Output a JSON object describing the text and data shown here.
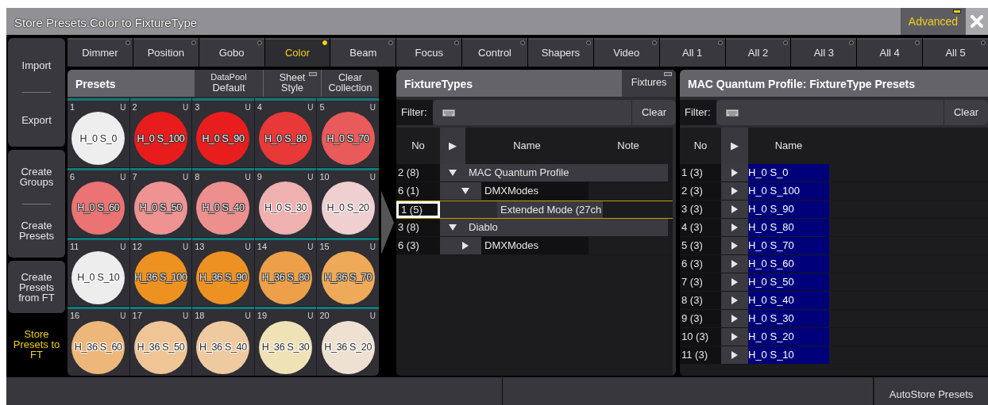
{
  "window": {
    "title": "Store Presets.Color to FixtureType"
  },
  "mode_button": {
    "label": "Advanced",
    "on": true
  },
  "sidebar": [
    {
      "items": [
        {
          "label": "Import",
          "selected": false
        },
        {
          "label": "Export",
          "selected": false
        }
      ]
    },
    {
      "items": [
        {
          "label": "Create Groups",
          "selected": false
        },
        {
          "label": "Create Presets",
          "selected": false
        }
      ]
    },
    {
      "items": [
        {
          "label": "Create Presets from FT",
          "selected": false
        }
      ]
    },
    {
      "items": [
        {
          "label": "Store Presets to FT",
          "selected": true
        }
      ]
    }
  ],
  "tabs": [
    {
      "label": "Dimmer",
      "selected": false
    },
    {
      "label": "Position",
      "selected": false
    },
    {
      "label": "Gobo",
      "selected": false
    },
    {
      "label": "Color",
      "selected": true
    },
    {
      "label": "Beam",
      "selected": false
    },
    {
      "label": "Focus",
      "selected": false
    },
    {
      "label": "Control",
      "selected": false
    },
    {
      "label": "Shapers",
      "selected": false
    },
    {
      "label": "Video",
      "selected": false
    },
    {
      "label": "All 1",
      "selected": false
    },
    {
      "label": "All 2",
      "selected": false
    },
    {
      "label": "All 3",
      "selected": false
    },
    {
      "label": "All 4",
      "selected": false
    },
    {
      "label": "All 5",
      "selected": false
    }
  ],
  "presets": {
    "title": "Presets",
    "datapool": {
      "label": "DataPool",
      "value": "Default"
    },
    "buttons": [
      "Sheet Style",
      "Clear Collection"
    ],
    "items": [
      {
        "number": "1",
        "flag": "U",
        "name": "H_0 S_0",
        "color": "#eeeeee"
      },
      {
        "number": "2",
        "flag": "U",
        "name": "H_0 S_100",
        "color": "#e81c1c"
      },
      {
        "number": "3",
        "flag": "U",
        "name": "H_0 S_90",
        "color": "#e81e1e"
      },
      {
        "number": "4",
        "flag": "U",
        "name": "H_0 S_80",
        "color": "#e83838"
      },
      {
        "number": "5",
        "flag": "U",
        "name": "H_0 S_70",
        "color": "#e95a5a"
      },
      {
        "number": "6",
        "flag": "U",
        "name": "H_0 S_60",
        "color": "#ec7373"
      },
      {
        "number": "7",
        "flag": "U",
        "name": "H_0 S_50",
        "color": "#ee9292"
      },
      {
        "number": "8",
        "flag": "U",
        "name": "H_0 S_40",
        "color": "#ed8f8f"
      },
      {
        "number": "9",
        "flag": "U",
        "name": "H_0 S_30",
        "color": "#efb0b0"
      },
      {
        "number": "10",
        "flag": "U",
        "name": "H_0 S_20",
        "color": "#efcfcf"
      },
      {
        "number": "11",
        "flag": "U",
        "name": "H_0 S_10",
        "color": "#ededed"
      },
      {
        "number": "12",
        "flag": "U",
        "name": "H_36 S_100",
        "color": "#ed9120"
      },
      {
        "number": "13",
        "flag": "U",
        "name": "H_36 S_90",
        "color": "#ed9222"
      },
      {
        "number": "14",
        "flag": "U",
        "name": "H_36 S_80",
        "color": "#eda049"
      },
      {
        "number": "15",
        "flag": "U",
        "name": "H_36 S_70",
        "color": "#eeaa58"
      },
      {
        "number": "16",
        "flag": "U",
        "name": "H_36 S_60",
        "color": "#eeb77a"
      },
      {
        "number": "17",
        "flag": "U",
        "name": "H_36 S_50",
        "color": "#efc596"
      },
      {
        "number": "18",
        "flag": "U",
        "name": "H_36 S_40",
        "color": "#efc9a0"
      },
      {
        "number": "19",
        "flag": "U",
        "name": "H_36 S_30",
        "color": "#efe2b6"
      },
      {
        "number": "20",
        "flag": "U",
        "name": "H_36 S_20",
        "color": "#efe1d2"
      }
    ]
  },
  "fixture_types": {
    "title": "FixtureTypes",
    "button": "Fixtures",
    "filter_label": "Filter:",
    "clear": "Clear",
    "columns": [
      "No",
      "▶",
      "Name",
      "Note"
    ],
    "rows": [
      {
        "no": "2 (8)",
        "name": "MAC Quantum Profile",
        "expanded": true,
        "selected": false,
        "children": [
          {
            "no": "6 (1)",
            "name": "DMXModes",
            "expanded": true,
            "selected": false,
            "children": [
              {
                "no": "1 (5)",
                "name": "Extended Mode (27ch",
                "selected": true
              }
            ]
          }
        ]
      },
      {
        "no": "3 (8)",
        "name": "Diablo",
        "expanded": true,
        "selected": false,
        "children": [
          {
            "no": "6 (3)",
            "name": "DMXModes",
            "expanded": false,
            "selected": false
          }
        ]
      }
    ]
  },
  "ft_presets": {
    "title": "MAC Quantum Profile: FixtureType Presets",
    "filter_label": "Filter:",
    "clear": "Clear",
    "columns": [
      "No",
      "▶",
      "Name"
    ],
    "rows": [
      {
        "no": "1 (3)",
        "name": "H_0 S_0",
        "selected": true
      },
      {
        "no": "2 (3)",
        "name": "H_0 S_100",
        "selected": true
      },
      {
        "no": "3 (3)",
        "name": "H_0 S_90",
        "selected": true
      },
      {
        "no": "4 (3)",
        "name": "H_0 S_80",
        "selected": true
      },
      {
        "no": "5 (3)",
        "name": "H_0 S_70",
        "selected": true
      },
      {
        "no": "6 (3)",
        "name": "H_0 S_60",
        "selected": true
      },
      {
        "no": "7 (3)",
        "name": "H_0 S_50",
        "selected": true
      },
      {
        "no": "8 (3)",
        "name": "H_0 S_40",
        "selected": true
      },
      {
        "no": "9 (3)",
        "name": "H_0 S_30",
        "selected": true
      },
      {
        "no": "10 (3)",
        "name": "H_0 S_20",
        "selected": true
      },
      {
        "no": "11 (3)",
        "name": "H_0 S_10",
        "selected": true
      }
    ]
  },
  "bottom_bar": {
    "button": "AutoStore Presets"
  }
}
